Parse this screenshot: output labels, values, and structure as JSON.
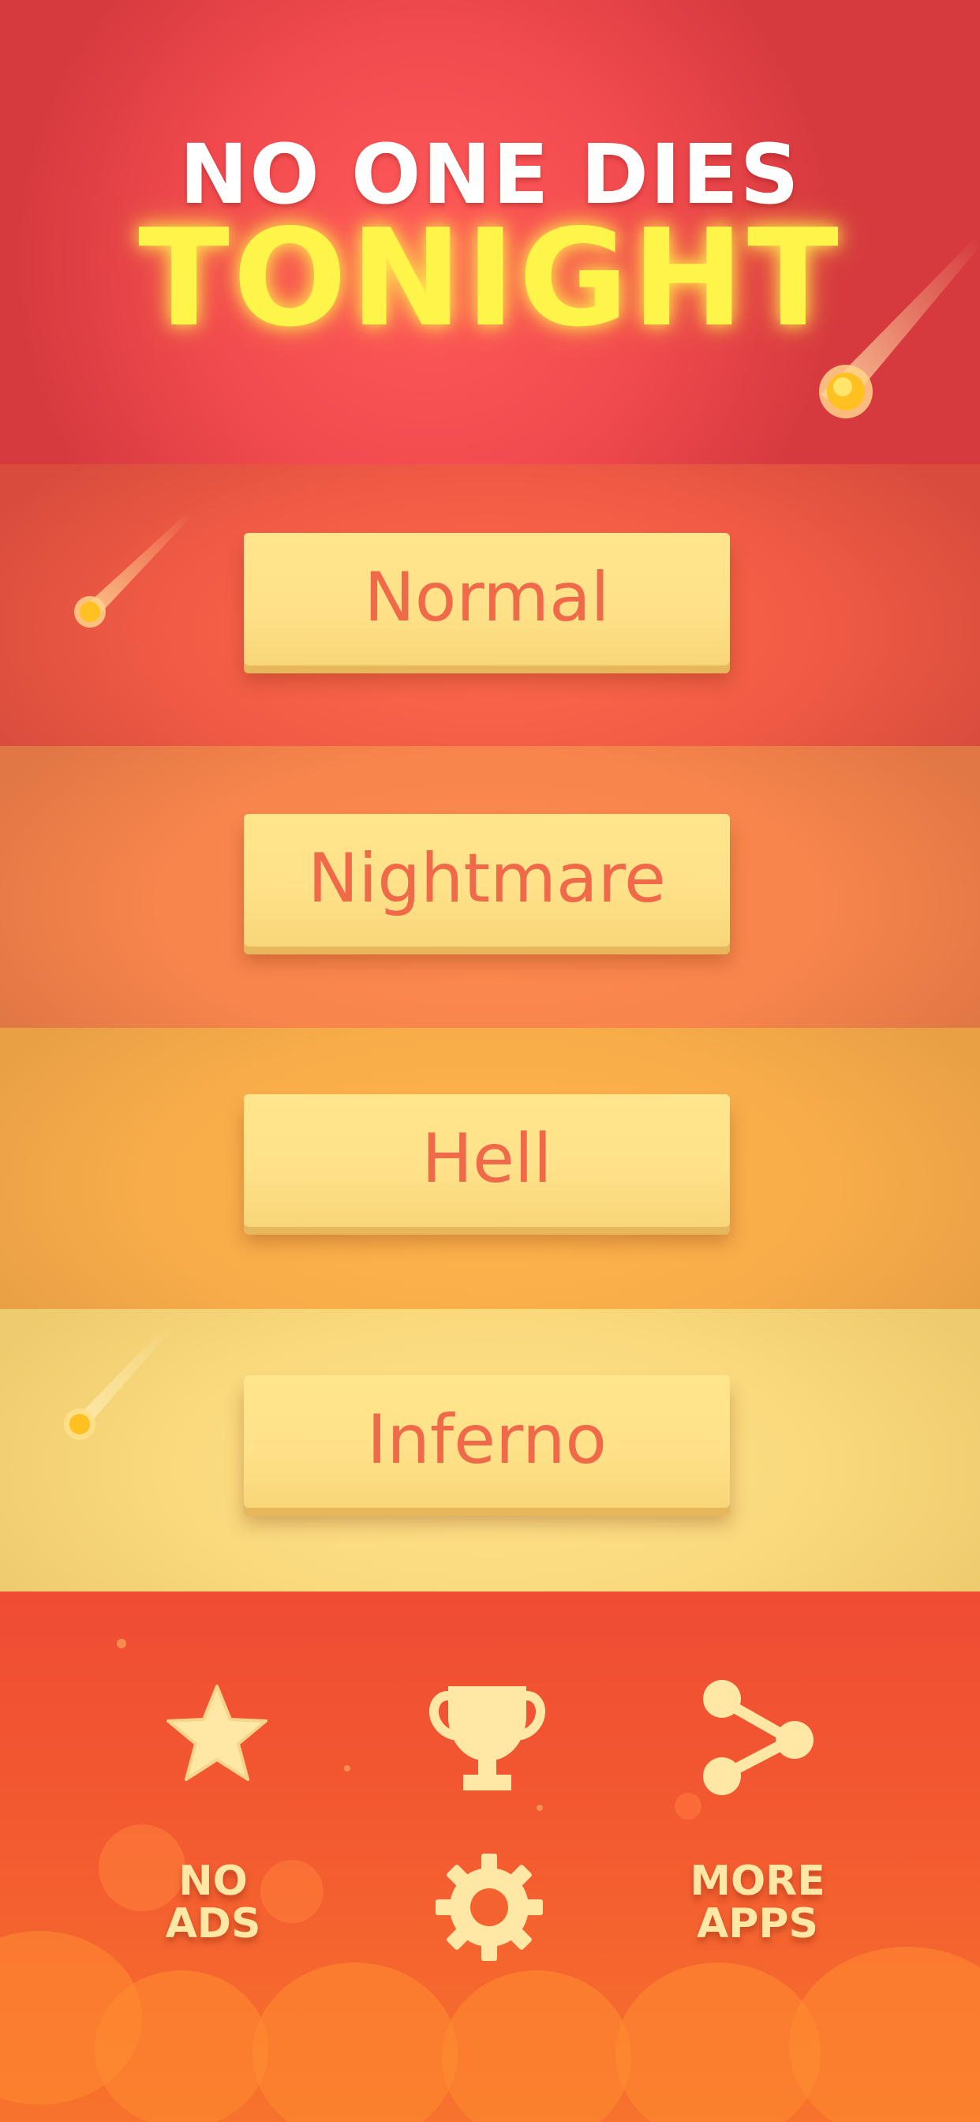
{
  "title": {
    "line1": "NO ONE DIES",
    "line2": "TONIGHT"
  },
  "difficulties": [
    {
      "label": "Normal"
    },
    {
      "label": "Nightmare"
    },
    {
      "label": "Hell"
    },
    {
      "label": "Inferno"
    }
  ],
  "menu": {
    "no_ads": "NO\nADS",
    "more_apps": "MORE\nAPPS",
    "icons": [
      "star-icon",
      "trophy-icon",
      "share-icon",
      "gear-icon"
    ]
  },
  "colors": {
    "title_white": "#ffffff",
    "title_yellow": "#fff44a",
    "button_fill": "#ffe58c",
    "button_text": "#f06a4a",
    "menu_icon": "#ffe7a6"
  }
}
